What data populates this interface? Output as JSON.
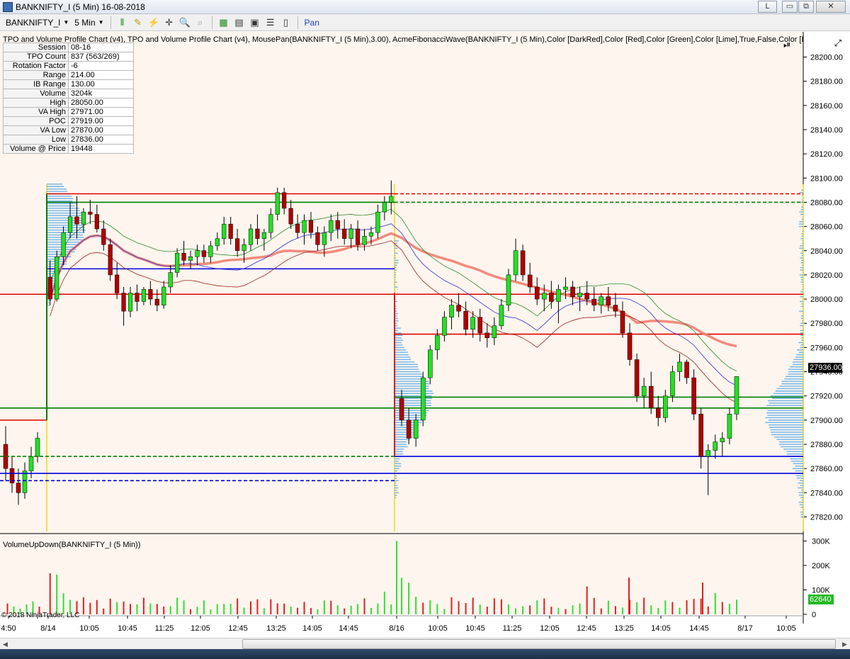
{
  "window": {
    "title": "BANKNIFTY_I (5 Min)  16-08-2018",
    "buttons": [
      "L",
      "▭",
      "⧉",
      "✕"
    ]
  },
  "toolbar": {
    "instrument": "BANKNIFTY_I",
    "interval": "5 Min",
    "pan_label": "Pan"
  },
  "chart": {
    "indicator_line": "TPO and Volume Profile Chart (v4),  TPO and Volume Profile Chart (v4), MousePan(BANKNIFTY_I (5 Min),3.00), AcmeFibonacciWave(BANKNIFTY_I (5 Min),Color [DarkRed],Color [Red],Color [Green],Color [Lime],True,False,Color [DarkGray],(",
    "volume_label": "VolumeUpDown(BANKNIFTY_I (5 Min))",
    "copyright": "© 2018 NinjaTrader, LLC",
    "current_price": "27936.00",
    "current_volume": "62640"
  },
  "info_table": [
    {
      "k": "Session",
      "v": "08-16"
    },
    {
      "k": "TPO Count",
      "v": "837 (563/269)"
    },
    {
      "k": "Rotation Factor",
      "v": "-6"
    },
    {
      "k": "Range",
      "v": "214.00"
    },
    {
      "k": "IB Range",
      "v": "130.00"
    },
    {
      "k": "Volume",
      "v": "3204k"
    },
    {
      "k": "High",
      "v": "28050.00"
    },
    {
      "k": "VA High",
      "v": "27971.00"
    },
    {
      "k": "POC",
      "v": "27919.00"
    },
    {
      "k": "VA Low",
      "v": "27870.00"
    },
    {
      "k": "Low",
      "v": "27836.00"
    },
    {
      "k": "Volume @ Price",
      "v": "19448"
    }
  ],
  "chart_data": {
    "type": "candlestick",
    "price_axis": {
      "ticks": [
        "28200.00",
        "28180.00",
        "28160.00",
        "28140.00",
        "28120.00",
        "28100.00",
        "28080.00",
        "28060.00",
        "28040.00",
        "28020.00",
        "28000.00",
        "27980.00",
        "27960.00",
        "27940.00",
        "27920.00",
        "27900.00",
        "27880.00",
        "27860.00",
        "27840.00",
        "27820.00"
      ],
      "range": [
        27808,
        28212
      ]
    },
    "volume_axis": {
      "ticks": [
        "300K",
        "200K",
        "100K",
        "0"
      ],
      "range": [
        0,
        310000
      ]
    },
    "time_axis": {
      "labels": [
        "4:50",
        "8/14",
        "10:05",
        "10:45",
        "11:25",
        "12:05",
        "12:45",
        "13:25",
        "14:05",
        "14:45",
        "8/16",
        "10:05",
        "10:45",
        "11:25",
        "12:05",
        "12:45",
        "13:25",
        "14:05",
        "14:45",
        "8/17",
        "10:05"
      ]
    },
    "sessions": [
      {
        "name": "8/14",
        "candles": [
          [
            28018,
            28032,
            27995,
            28000
          ],
          [
            28000,
            28040,
            27998,
            28035
          ],
          [
            28035,
            28060,
            28028,
            28055
          ],
          [
            28055,
            28080,
            28050,
            28068
          ],
          [
            28068,
            28085,
            28050,
            28062
          ],
          [
            28062,
            28075,
            28055,
            28072
          ],
          [
            28072,
            28082,
            28062,
            28070
          ],
          [
            28070,
            28078,
            28055,
            28058
          ],
          [
            28058,
            28065,
            28040,
            28045
          ],
          [
            28045,
            28050,
            28015,
            28020
          ],
          [
            28020,
            28030,
            28000,
            28005
          ],
          [
            28005,
            28010,
            27978,
            27990
          ],
          [
            27990,
            28010,
            27985,
            28005
          ],
          [
            28005,
            28012,
            27990,
            27998
          ],
          [
            27998,
            28010,
            27995,
            28008
          ],
          [
            28008,
            28015,
            27995,
            28000
          ],
          [
            28000,
            28008,
            27990,
            27995
          ],
          [
            27995,
            28015,
            27992,
            28010
          ],
          [
            28010,
            28028,
            28005,
            28022
          ],
          [
            28022,
            28042,
            28018,
            28038
          ],
          [
            28038,
            28048,
            28028,
            28032
          ],
          [
            28032,
            28040,
            28025,
            28035
          ],
          [
            28035,
            28045,
            28028,
            28040
          ],
          [
            28040,
            28045,
            28030,
            28035
          ],
          [
            28035,
            28048,
            28030,
            28044
          ],
          [
            28044,
            28055,
            28040,
            28050
          ],
          [
            28050,
            28068,
            28045,
            28062
          ],
          [
            28062,
            28068,
            28045,
            28050
          ],
          [
            28050,
            28058,
            28035,
            28040
          ],
          [
            28040,
            28050,
            28030,
            28045
          ],
          [
            28045,
            28062,
            28040,
            28058
          ],
          [
            28058,
            28070,
            28045,
            28050
          ],
          [
            28050,
            28058,
            28040,
            28055
          ],
          [
            28055,
            28075,
            28050,
            28070
          ],
          [
            28070,
            28092,
            28065,
            28088
          ],
          [
            28088,
            28092,
            28070,
            28075
          ],
          [
            28075,
            28082,
            28058,
            28062
          ],
          [
            28062,
            28070,
            28050,
            28055
          ],
          [
            28055,
            28070,
            28045,
            28065
          ],
          [
            28065,
            28072,
            28050,
            28055
          ],
          [
            28055,
            28060,
            28040,
            28045
          ],
          [
            28045,
            28060,
            28035,
            28055
          ],
          [
            28055,
            28070,
            28048,
            28065
          ],
          [
            28065,
            28072,
            28050,
            28058
          ],
          [
            28058,
            28066,
            28045,
            28050
          ],
          [
            28050,
            28062,
            28042,
            28058
          ],
          [
            28058,
            28065,
            28040,
            28045
          ],
          [
            28045,
            28058,
            28040,
            28052
          ],
          [
            28052,
            28060,
            28045,
            28055
          ],
          [
            28055,
            28078,
            28050,
            28072
          ],
          [
            28072,
            28085,
            28065,
            28080
          ],
          [
            28080,
            28098,
            28070,
            28085
          ]
        ]
      },
      {
        "name": "8/16",
        "candles": [
          [
            27918,
            27925,
            27895,
            27900
          ],
          [
            27900,
            27910,
            27880,
            27885
          ],
          [
            27885,
            27905,
            27878,
            27900
          ],
          [
            27900,
            27940,
            27895,
            27935
          ],
          [
            27935,
            27962,
            27930,
            27958
          ],
          [
            27958,
            27975,
            27950,
            27970
          ],
          [
            27970,
            27990,
            27965,
            27985
          ],
          [
            27985,
            28000,
            27975,
            27995
          ],
          [
            27995,
            28005,
            27985,
            27990
          ],
          [
            27990,
            27998,
            27970,
            27975
          ],
          [
            27975,
            27990,
            27968,
            27985
          ],
          [
            27985,
            27992,
            27965,
            27972
          ],
          [
            27972,
            27980,
            27960,
            27968
          ],
          [
            27968,
            27985,
            27962,
            27978
          ],
          [
            27978,
            28000,
            27975,
            27995
          ],
          [
            27995,
            28025,
            27990,
            28020
          ],
          [
            28020,
            28050,
            28015,
            28040
          ],
          [
            28040,
            28045,
            28015,
            28020
          ],
          [
            28020,
            28030,
            28005,
            28010
          ],
          [
            28010,
            28018,
            27995,
            28000
          ],
          [
            28000,
            28012,
            27990,
            28005
          ],
          [
            28005,
            28015,
            27992,
            27998
          ],
          [
            27998,
            28012,
            27980,
            28008
          ],
          [
            28008,
            28018,
            28000,
            28010
          ],
          [
            28010,
            28015,
            27995,
            28002
          ],
          [
            28002,
            28010,
            27990,
            28005
          ],
          [
            28005,
            28015,
            27995,
            28000
          ],
          [
            28000,
            28010,
            27990,
            27995
          ],
          [
            27995,
            28005,
            27988,
            28002
          ],
          [
            28002,
            28010,
            27990,
            27995
          ],
          [
            27995,
            28005,
            27985,
            27990
          ],
          [
            27990,
            27998,
            27968,
            27972
          ],
          [
            27972,
            27980,
            27945,
            27950
          ],
          [
            27950,
            27955,
            27915,
            27920
          ],
          [
            27920,
            27935,
            27910,
            27928
          ],
          [
            27928,
            27940,
            27905,
            27910
          ],
          [
            27910,
            27920,
            27895,
            27902
          ],
          [
            27902,
            27925,
            27898,
            27920
          ],
          [
            27920,
            27945,
            27915,
            27940
          ],
          [
            27940,
            27955,
            27932,
            27948
          ],
          [
            27948,
            27950,
            27930,
            27935
          ],
          [
            27935,
            27942,
            27900,
            27905
          ],
          [
            27905,
            27910,
            27860,
            27870
          ],
          [
            27870,
            27880,
            27838,
            27875
          ],
          [
            27875,
            27888,
            27868,
            27882
          ],
          [
            27882,
            27890,
            27870,
            27885
          ],
          [
            27885,
            27910,
            27880,
            27905
          ],
          [
            27905,
            27936,
            27900,
            27936
          ]
        ]
      }
    ],
    "levels": [
      {
        "price": 28087,
        "color": "#e00000",
        "style": "solid",
        "session": "8/14"
      },
      {
        "price": 28080,
        "color": "#008000",
        "style": "solid",
        "session": "8/14"
      },
      {
        "price": 28025,
        "color": "#0000e0",
        "style": "solid",
        "session": "8/14"
      },
      {
        "price": 28004,
        "color": "#e00000",
        "style": "solid",
        "session": "all"
      },
      {
        "price": 27971,
        "color": "#e00000",
        "style": "solid",
        "session": "8/16"
      },
      {
        "price": 27919,
        "color": "#008000",
        "style": "solid",
        "session": "8/16"
      },
      {
        "price": 27910,
        "color": "#008000",
        "style": "solid",
        "session": "all"
      },
      {
        "price": 27870,
        "color": "#0000e0",
        "style": "solid",
        "session": "8/16"
      },
      {
        "price": 27856,
        "color": "#0000e0",
        "style": "solid",
        "session": "all"
      },
      {
        "price": 28087,
        "color": "#e00000",
        "style": "dashed",
        "session": "8/16"
      },
      {
        "price": 28080,
        "color": "#008000",
        "style": "dashed",
        "session": "8/16"
      },
      {
        "price": 27870,
        "color": "#008000",
        "style": "dashed",
        "session": "8/14"
      },
      {
        "price": 27850,
        "color": "#0000e0",
        "style": "dashed",
        "session": "8/14"
      }
    ]
  }
}
